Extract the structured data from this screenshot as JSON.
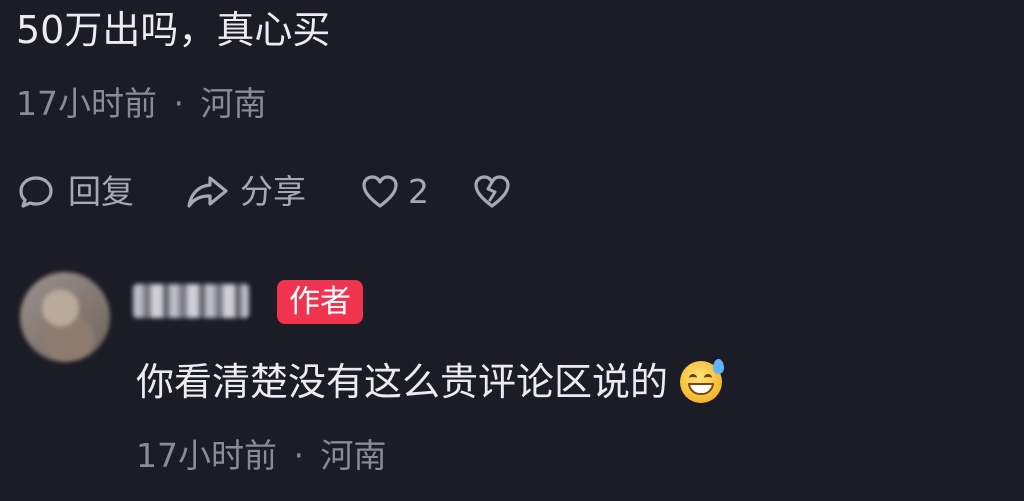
{
  "top_comment": {
    "text": "50万出吗，真心买",
    "time": "17小时前",
    "separator": "·",
    "location": "河南",
    "actions": {
      "reply_label": "回复",
      "share_label": "分享",
      "like_count": "2"
    }
  },
  "reply": {
    "badge": "作者",
    "text": "你看清楚没有这么贵评论区说的",
    "time": "17小时前",
    "separator": "·",
    "location": "河南"
  },
  "colors": {
    "background": "#1c1c26",
    "author_badge": "#f0334f"
  },
  "icons": [
    "comment-icon",
    "share-icon",
    "heart-icon",
    "broken-heart-icon",
    "grinning-sweat-emoji"
  ]
}
